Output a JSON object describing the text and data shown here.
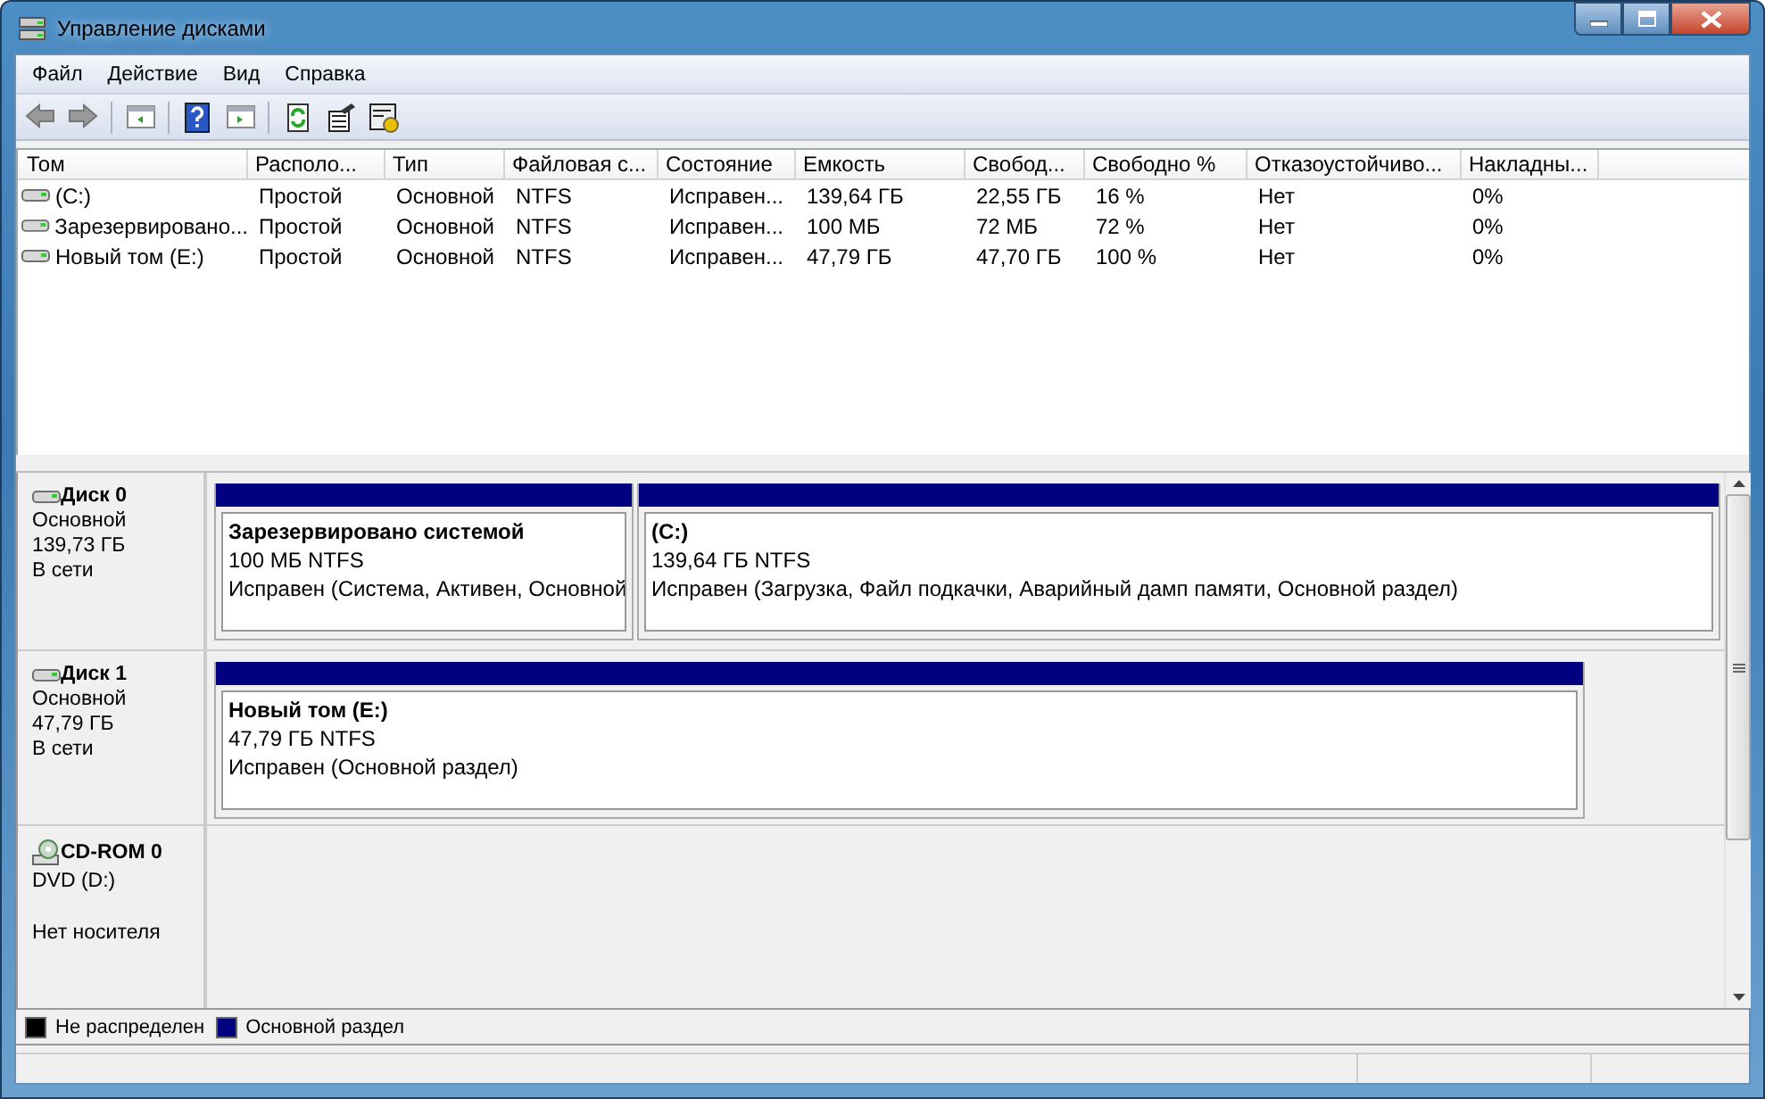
{
  "window": {
    "title": "Управление дисками"
  },
  "menu": [
    {
      "label": "Файл"
    },
    {
      "label": "Действие"
    },
    {
      "label": "Вид"
    },
    {
      "label": "Справка"
    }
  ],
  "table": {
    "columns": [
      "Том",
      "Располо...",
      "Тип",
      "Файловая с...",
      "Состояние",
      "Емкость",
      "Свобод...",
      "Свободно %",
      "Отказоустойчиво...",
      "Накладны..."
    ],
    "rows": [
      [
        "(C:)",
        "Простой",
        "Основной",
        "NTFS",
        "Исправен...",
        "139,64 ГБ",
        "22,55 ГБ",
        "16 %",
        "Нет",
        "0%"
      ],
      [
        "Зарезервировано...",
        "Простой",
        "Основной",
        "NTFS",
        "Исправен...",
        "100 МБ",
        "72 МБ",
        "72 %",
        "Нет",
        "0%"
      ],
      [
        "Новый том (E:)",
        "Простой",
        "Основной",
        "NTFS",
        "Исправен...",
        "47,79 ГБ",
        "47,70 ГБ",
        "100 %",
        "Нет",
        "0%"
      ]
    ]
  },
  "disks": [
    {
      "kind": "disk",
      "name": "Диск 0",
      "lines": [
        "Основной",
        "139,73 ГБ",
        "В сети"
      ],
      "partitions": [
        {
          "title": "Зарезервировано системой",
          "size": "100 МБ NTFS",
          "status": "Исправен (Система, Активен, Основной",
          "color": "#000080"
        },
        {
          "title": "(C:)",
          "size": "139,64 ГБ NTFS",
          "status": "Исправен (Загрузка, Файл подкачки, Аварийный дамп памяти, Основной раздел)",
          "color": "#000080"
        }
      ]
    },
    {
      "kind": "disk",
      "name": "Диск 1",
      "lines": [
        "Основной",
        "47,79 ГБ",
        "В сети"
      ],
      "partitions": [
        {
          "title": "Новый том  (E:)",
          "size": "47,79 ГБ NTFS",
          "status": "Исправен (Основной раздел)",
          "color": "#000080"
        }
      ]
    },
    {
      "kind": "cdrom",
      "name": "CD-ROM 0",
      "lines": [
        "DVD (D:)",
        "Нет носителя"
      ]
    }
  ],
  "legend": [
    {
      "label": "Не распределен",
      "color": "#000000"
    },
    {
      "label": "Основной раздел",
      "color": "#000080"
    }
  ]
}
